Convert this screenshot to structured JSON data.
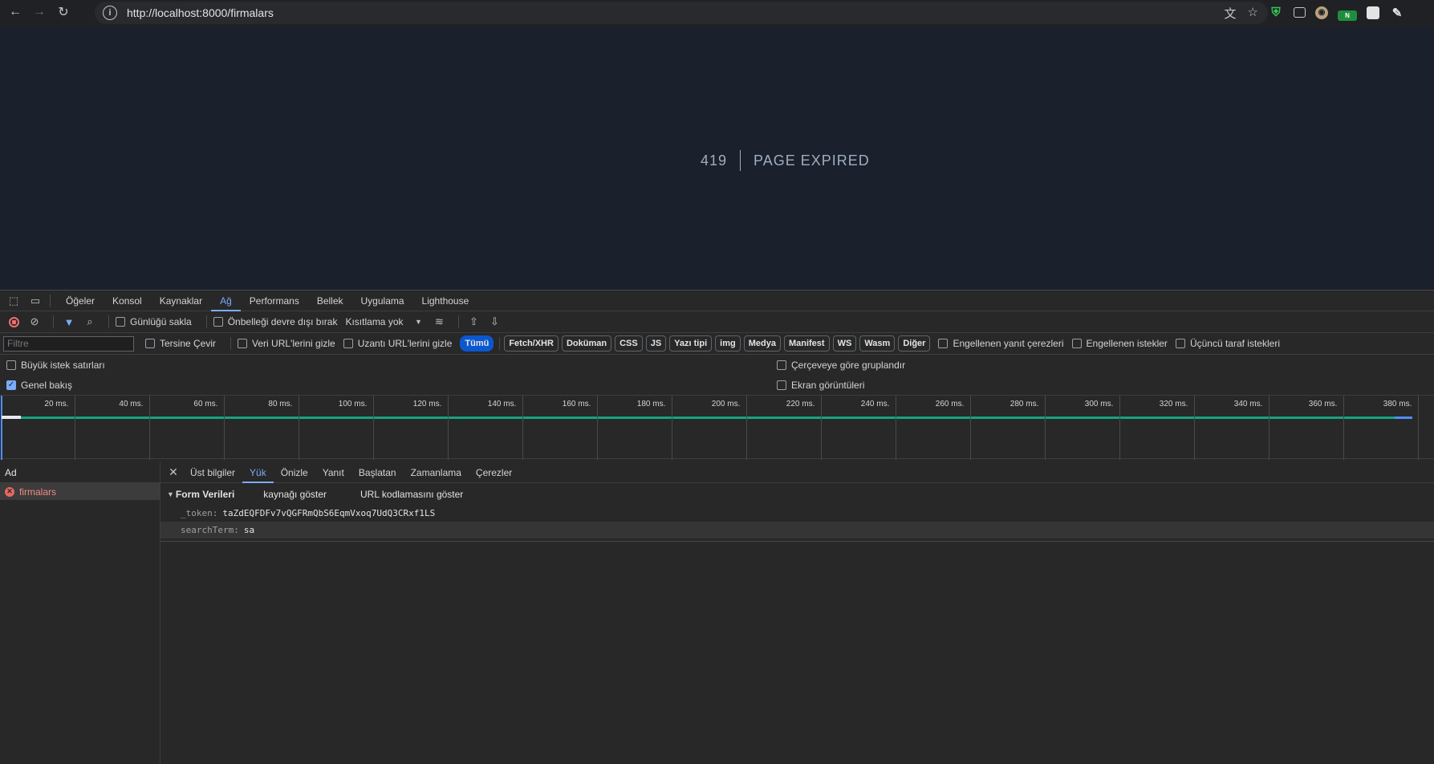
{
  "browser": {
    "url": "http://localhost:8000/firmalars"
  },
  "page": {
    "error_code": "419",
    "error_message": "PAGE EXPIRED"
  },
  "devtools": {
    "tabs": [
      "Öğeler",
      "Konsol",
      "Kaynaklar",
      "Ağ",
      "Performans",
      "Bellek",
      "Uygulama",
      "Lighthouse"
    ],
    "active_tab": "Ağ",
    "toolbar": {
      "preserve_log": "Günlüğü sakla",
      "disable_cache": "Önbelleği devre dışı bırak",
      "throttling": "Kısıtlama yok"
    },
    "filter": {
      "placeholder": "Filtre",
      "invert": "Tersine Çevir",
      "hide_data_urls": "Veri URL'lerini gizle",
      "hide_ext_urls": "Uzantı URL'lerini gizle",
      "types": [
        "Tümü",
        "Fetch/XHR",
        "Doküman",
        "CSS",
        "JS",
        "Yazı tipi",
        "img",
        "Medya",
        "Manifest",
        "WS",
        "Wasm",
        "Diğer"
      ],
      "blocked_cookies": "Engellenen yanıt çerezleri",
      "blocked_requests": "Engellenen istekler",
      "third_party": "Üçüncü taraf istekleri"
    },
    "options": {
      "big_rows": "Büyük istek satırları",
      "group_by_frame": "Çerçeveye göre gruplandır",
      "overview": "Genel bakış",
      "screenshots": "Ekran görüntüleri"
    },
    "timeline_ticks": [
      "20 ms.",
      "40 ms.",
      "60 ms.",
      "80 ms.",
      "100 ms.",
      "120 ms.",
      "140 ms.",
      "160 ms.",
      "180 ms.",
      "200 ms.",
      "220 ms.",
      "240 ms.",
      "260 ms.",
      "280 ms.",
      "300 ms.",
      "320 ms.",
      "340 ms.",
      "360 ms.",
      "380 ms."
    ],
    "requests": {
      "column_name": "Ad",
      "items": [
        {
          "name": "firmalars",
          "status": "error"
        }
      ]
    },
    "details": {
      "tabs": [
        "Üst bilgiler",
        "Yük",
        "Önizle",
        "Yanıt",
        "Başlatan",
        "Zamanlama",
        "Çerezler"
      ],
      "active_tab": "Yük",
      "section_title": "Form Verileri",
      "view_source": "kaynağı göster",
      "view_url_encoded": "URL kodlamasını göster",
      "fields": [
        {
          "key": "_token:",
          "value": "taZdEQFDFv7vQGFRmQbS6EqmVxoq7UdQ3CRxf1LS"
        },
        {
          "key": "searchTerm:",
          "value": "sa"
        }
      ]
    }
  }
}
